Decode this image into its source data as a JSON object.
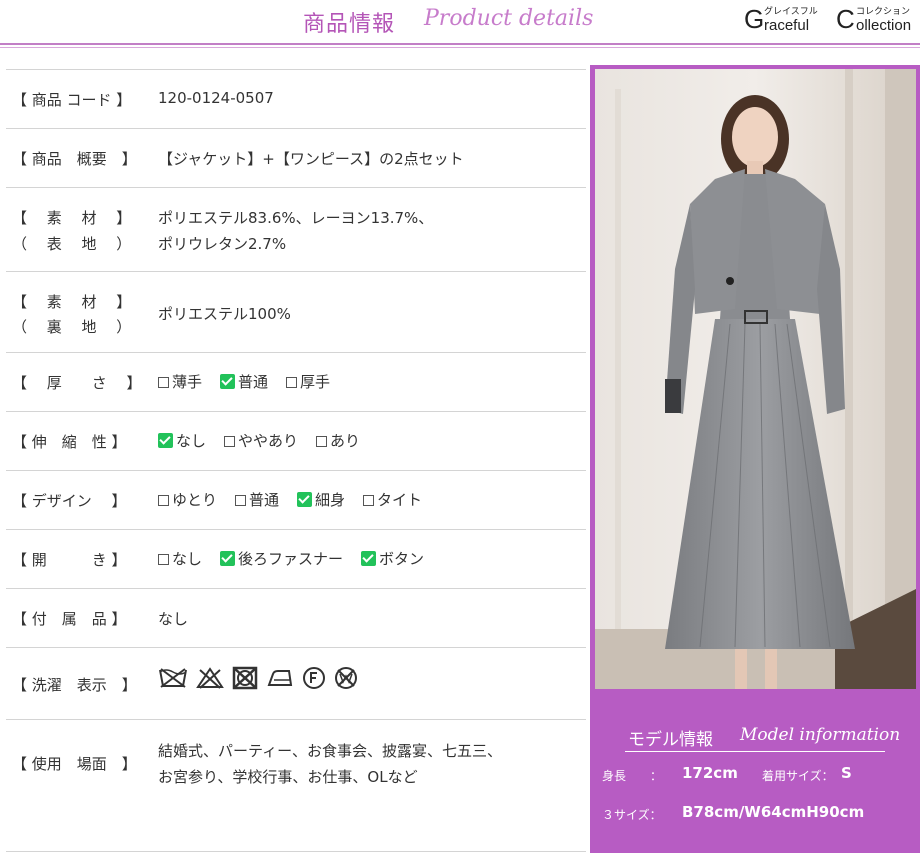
{
  "header": {
    "title_jp": "商品情報",
    "title_en": "Product details",
    "logo": {
      "initial_g": "G",
      "word1_rest": "raceful",
      "initial_c": "C",
      "word2_rest": "ollection",
      "kana1": "グレイスフル",
      "kana2": "コレクション"
    }
  },
  "rows": [
    {
      "label": "【 商品 コード 】",
      "value": "120-0124-0507"
    },
    {
      "label": "【 商品　概要　】",
      "value": "【ジャケット】+【ワンピース】の2点セット"
    },
    {
      "label1": "【　 素　 材　 】",
      "label2": "（　 表　 地　 ）",
      "value1": "ポリエステル83.6%、レーヨン13.7%、",
      "value2": "ポリウレタン2.7%"
    },
    {
      "label1": "【　 素　 材　 】",
      "label2": "（　 裏　 地　 ）",
      "value": "ポリエステル100%"
    },
    {
      "label": "【　 厚　　さ　 】",
      "options": [
        {
          "text": "薄手",
          "checked": false
        },
        {
          "text": "普通",
          "checked": true
        },
        {
          "text": "厚手",
          "checked": false
        }
      ]
    },
    {
      "label": "【 伸　縮　性 】",
      "options": [
        {
          "text": "なし",
          "checked": true
        },
        {
          "text": "ややあり",
          "checked": false
        },
        {
          "text": "あり",
          "checked": false
        }
      ]
    },
    {
      "label": "【 デザイン　 】",
      "options": [
        {
          "text": "ゆとり",
          "checked": false
        },
        {
          "text": "普通",
          "checked": false
        },
        {
          "text": "細身",
          "checked": true
        },
        {
          "text": "タイト",
          "checked": false
        }
      ]
    },
    {
      "label": "【 開　　　き 】",
      "options": [
        {
          "text": "なし",
          "checked": false
        },
        {
          "text": "後ろファスナー",
          "checked": true
        },
        {
          "text": "ボタン",
          "checked": true
        }
      ]
    },
    {
      "label": "【 付　属　品 】",
      "value": "なし"
    },
    {
      "label": "【 洗濯　表示　】",
      "icons": [
        "no-wash-icon",
        "no-bleach-icon",
        "no-tumble-dry-icon",
        "iron-low-icon",
        "dry-clean-f-icon",
        "no-wet-clean-icon"
      ]
    },
    {
      "label": "【 使用　場面　】",
      "value1": "結婚式、パーティー、お食事会、披露宴、七五三、",
      "value2": "お宮参り、学校行事、お仕事、OLなど"
    }
  ],
  "model": {
    "title_jp": "モデル情報",
    "title_en": "Model information",
    "height_label": "身長　　：",
    "height_value": "172cm",
    "size_label": "着用サイズ：",
    "size_value": "S",
    "measure_label": "３サイズ：",
    "measure_value": "B78cm/W64cmH90cm"
  },
  "colors": {
    "accent": "#b75cc3",
    "title": "#b455b7",
    "check": "#22c25a"
  }
}
